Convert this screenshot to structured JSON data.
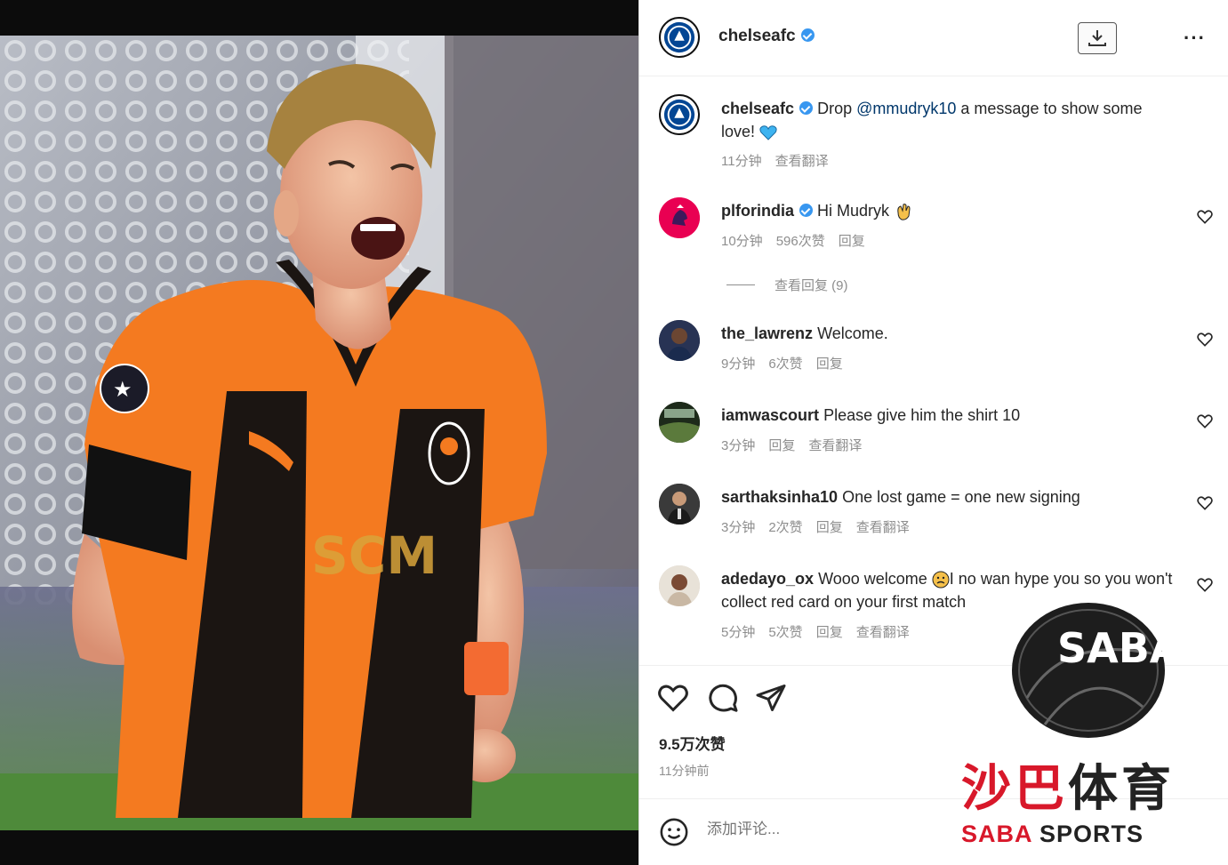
{
  "post": {
    "author": "chelseafc",
    "verified": true
  },
  "header": {
    "username": "chelseafc",
    "download_icon": "download-icon",
    "more_icon": "more-options-icon",
    "more_label": "···"
  },
  "caption": {
    "username": "chelseafc",
    "text_before": "Drop ",
    "mention": "@mmudryk10",
    "text_after": " a message to show some love! ",
    "emoji": "blue-heart",
    "time": "11分钟",
    "translate": "查看翻译"
  },
  "comments": [
    {
      "username": "plforindia",
      "verified": true,
      "text": "Hi Mudryk ",
      "emoji": "waving-hand",
      "time": "10分钟",
      "likes": "596次赞",
      "reply": "回复",
      "view_replies": "查看回复 (9)"
    },
    {
      "username": "the_lawrenz",
      "text": "Welcome.",
      "time": "9分钟",
      "likes": "6次赞",
      "reply": "回复"
    },
    {
      "username": "iamwascourt",
      "text": "Please give him the shirt 10",
      "time": "3分钟",
      "reply": "回复",
      "translate": "查看翻译"
    },
    {
      "username": "sarthaksinha10",
      "text": "One lost game = one new signing",
      "time": "3分钟",
      "likes": "2次赞",
      "reply": "回复",
      "translate": "查看翻译"
    },
    {
      "username": "adedayo_ox",
      "text_before": "Wooo welcome ",
      "emoji": "sad-face",
      "text_after": "I no wan hype you so you won't collect red card on your first match ",
      "time": "5分钟",
      "likes": "5次赞",
      "reply": "回复",
      "translate": "查看翻译"
    }
  ],
  "actions": {
    "like_icon": "heart-icon",
    "comment_icon": "comment-icon",
    "share_icon": "share-icon",
    "likes_count": "9.5万次赞",
    "posted_ago": "11分钟前"
  },
  "add_comment": {
    "emoji_icon": "emoji-icon",
    "placeholder": "添加评论..."
  },
  "watermark": {
    "logo_text": "SABA",
    "brand_cn_red": "沙巴",
    "brand_cn": "体育",
    "brand_en_red": "SABA",
    "brand_en": " SPORTS"
  },
  "colors": {
    "accent_blue": "#3897f0",
    "mention": "#00376b",
    "meta_gray": "#8e8e8e",
    "brand_red": "#d8182a",
    "jersey_orange": "#f47a20"
  }
}
